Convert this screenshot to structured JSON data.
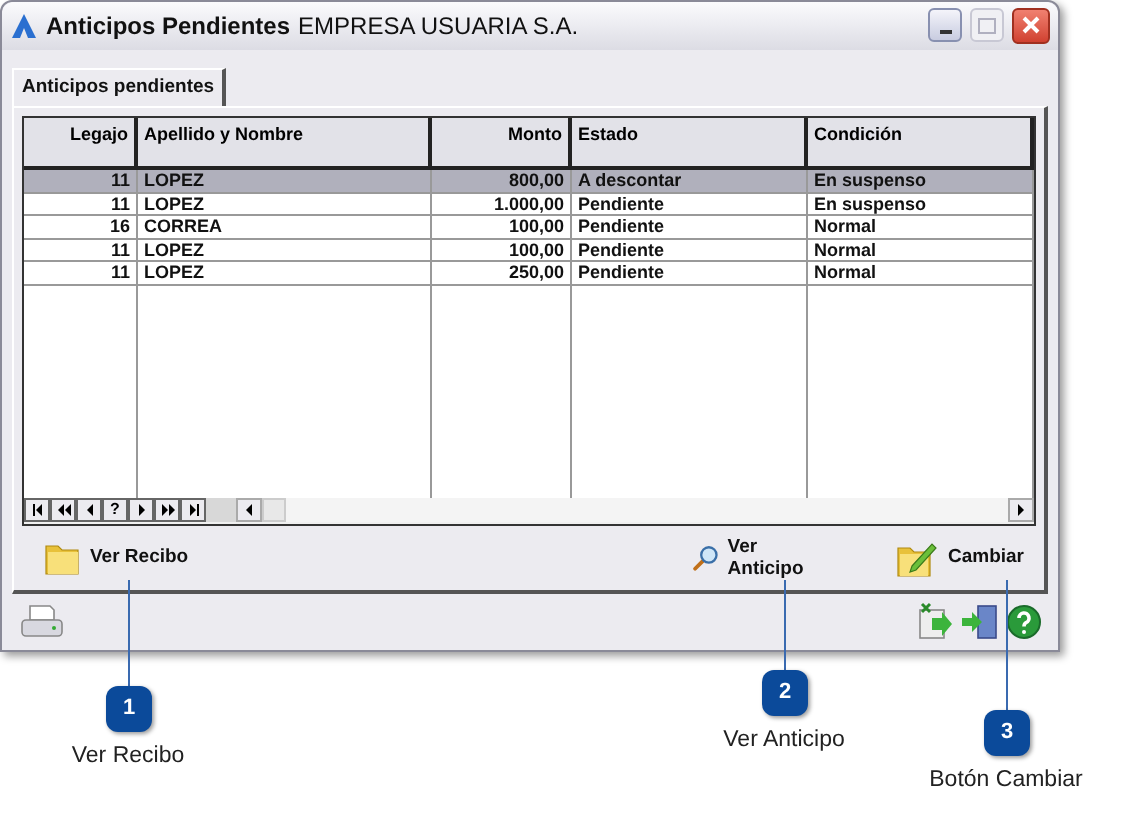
{
  "window": {
    "title": "Anticipos Pendientes",
    "subtitle": "EMPRESA USUARIA S.A."
  },
  "tabs": [
    {
      "label": "Anticipos pendientes",
      "selected": true
    }
  ],
  "table": {
    "columns": [
      {
        "label": "Legajo"
      },
      {
        "label": "Apellido y Nombre"
      },
      {
        "label": "Monto"
      },
      {
        "label": "Estado"
      },
      {
        "label": "Condición"
      }
    ],
    "rows": [
      {
        "selected": true,
        "cells": [
          "11",
          "LOPEZ",
          "800,00",
          "A descontar",
          "En suspenso"
        ]
      },
      {
        "selected": false,
        "cells": [
          "11",
          "LOPEZ",
          "1.000,00",
          "Pendiente",
          "En suspenso"
        ]
      },
      {
        "selected": false,
        "cells": [
          "16",
          "CORREA",
          "100,00",
          "Pendiente",
          "Normal"
        ]
      },
      {
        "selected": false,
        "cells": [
          "11",
          "LOPEZ",
          "100,00",
          "Pendiente",
          "Normal"
        ]
      },
      {
        "selected": false,
        "cells": [
          "11",
          "LOPEZ",
          "250,00",
          "Pendiente",
          "Normal"
        ]
      }
    ]
  },
  "navigator": [
    {
      "kind": "first"
    },
    {
      "kind": "prior-page"
    },
    {
      "kind": "prior"
    },
    {
      "kind": "text",
      "label": "?"
    },
    {
      "kind": "next"
    },
    {
      "kind": "next-page"
    },
    {
      "kind": "last"
    }
  ],
  "actions": [
    {
      "kind": "folder",
      "label": "Ver Recibo"
    },
    {
      "kind": "magnifier",
      "label": "Ver Anticipo"
    },
    {
      "kind": "pencil",
      "label": "Cambiar"
    }
  ],
  "callouts": [
    {
      "number": "1",
      "label": "Ver Recibo"
    },
    {
      "number": "2",
      "label": "Ver Anticipo"
    },
    {
      "number": "3",
      "label": "Botón Cambiar"
    }
  ]
}
